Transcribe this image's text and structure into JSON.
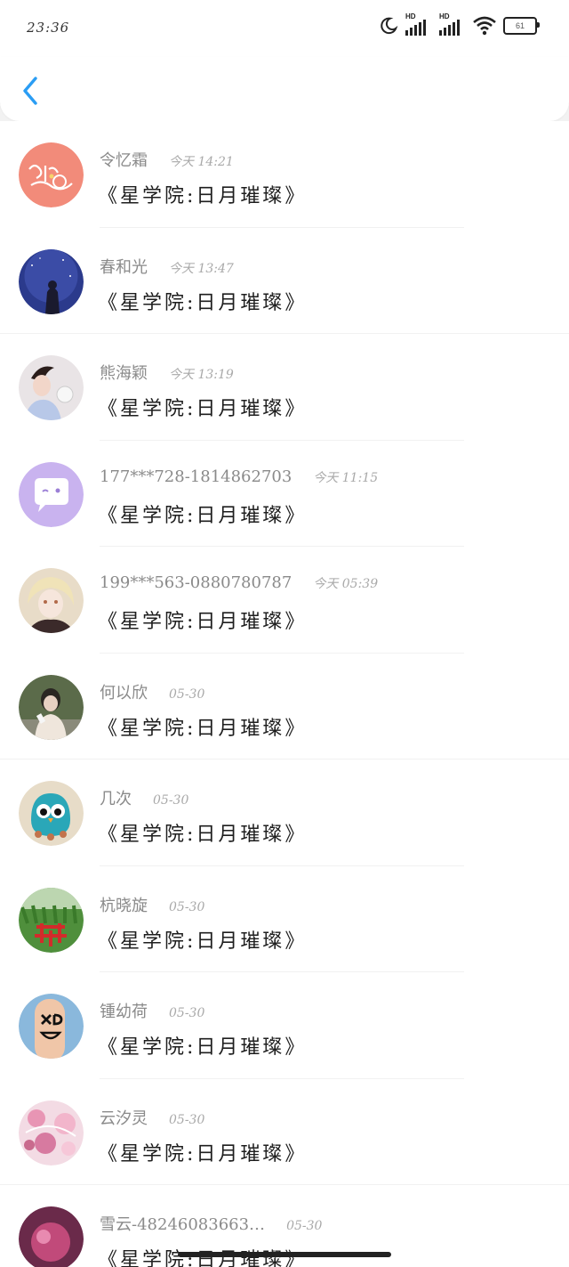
{
  "status_bar": {
    "time": "23:36",
    "signal1_label": "HD",
    "signal2_label": "HD",
    "battery_level": "61"
  },
  "messages": [
    {
      "name": "令忆霜",
      "time": "今天 14:21",
      "preview": "《星学院:日月璀璨》"
    },
    {
      "name": "春和光",
      "time": "今天 13:47",
      "preview": "《星学院:日月璀璨》"
    },
    {
      "name": "熊海颖",
      "time": "今天 13:19",
      "preview": "《星学院:日月璀璨》"
    },
    {
      "name": "177***728-1814862703",
      "time": "今天 11:15",
      "preview": "《星学院:日月璀璨》"
    },
    {
      "name": "199***563-0880780787",
      "time": "今天 05:39",
      "preview": "《星学院:日月璀璨》"
    },
    {
      "name": "何以欣",
      "time": "05-30",
      "preview": "《星学院:日月璀璨》"
    },
    {
      "name": "几次",
      "time": "05-30",
      "preview": "《星学院:日月璀璨》"
    },
    {
      "name": "杭晓旋",
      "time": "05-30",
      "preview": "《星学院:日月璀璨》"
    },
    {
      "name": "锺幼荷",
      "time": "05-30",
      "preview": "《星学院:日月璀璨》"
    },
    {
      "name": "云汐灵",
      "time": "05-30",
      "preview": "《星学院:日月璀璨》"
    },
    {
      "name": "雪云-48246083663…",
      "time": "05-30",
      "preview": "《星学院:日月璀璨》"
    }
  ],
  "colors": {
    "accent": "#2a9df4",
    "name_text": "#8a8a8a",
    "time_text": "#a9a9a9",
    "preview_text": "#1e1e1e"
  }
}
